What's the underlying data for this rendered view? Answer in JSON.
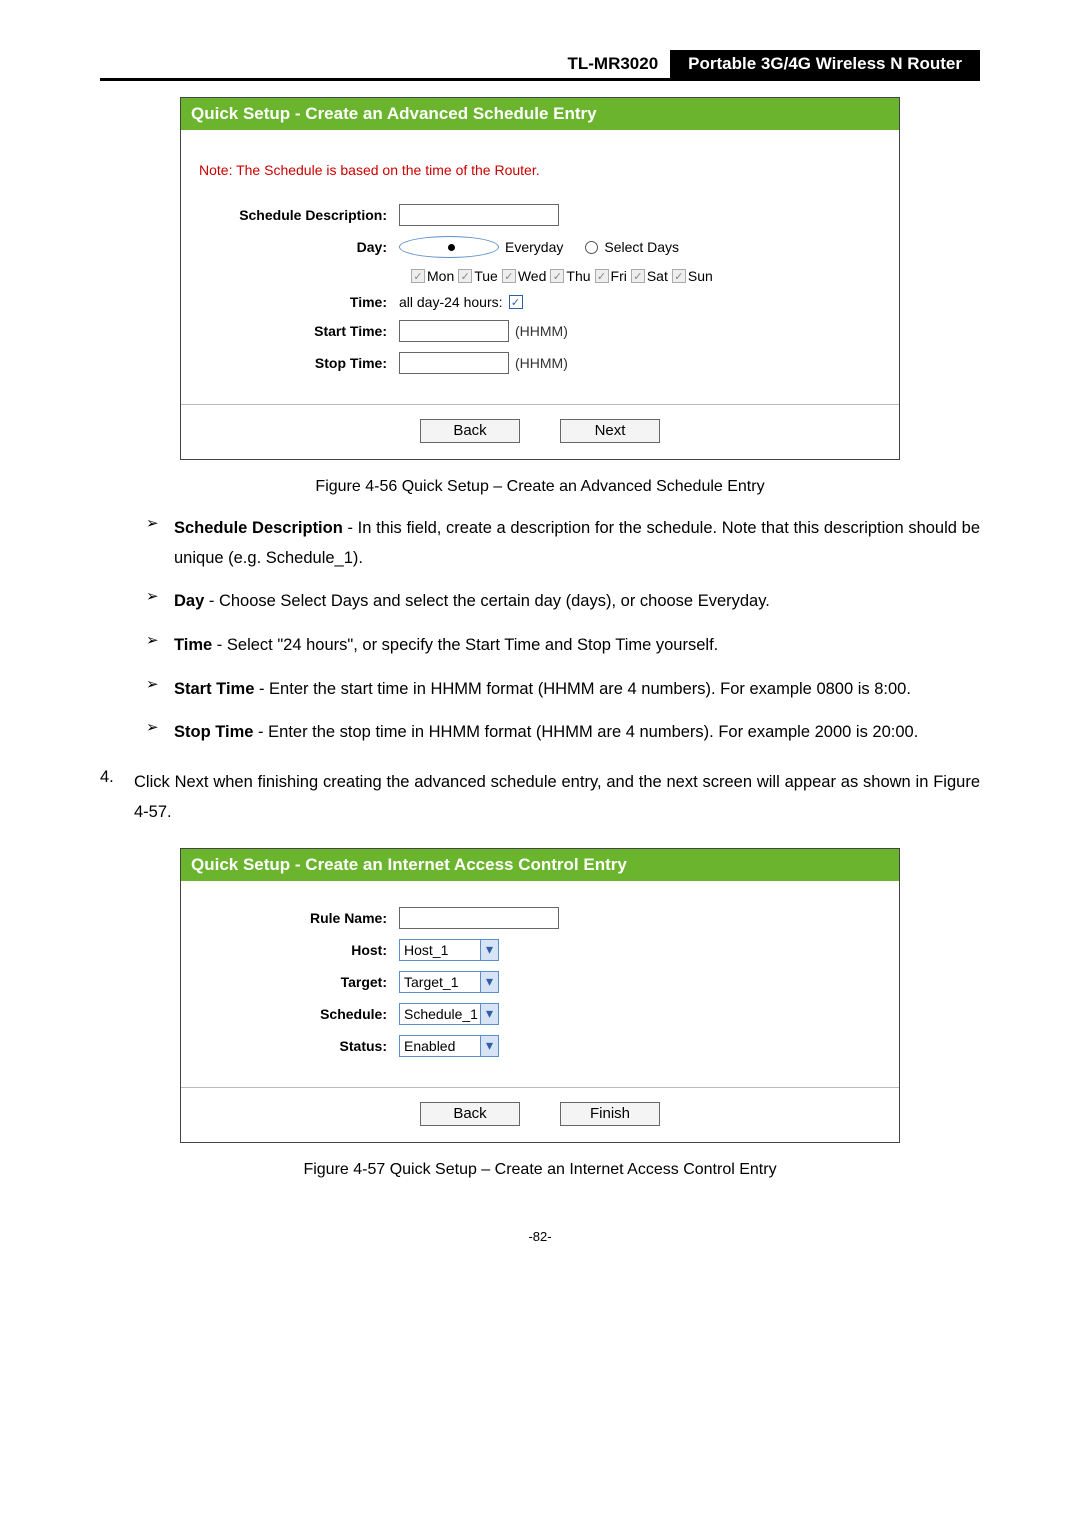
{
  "header": {
    "model": "TL-MR3020",
    "product": "Portable 3G/4G Wireless N Router"
  },
  "fig1": {
    "title": "Quick Setup - Create an Advanced Schedule Entry",
    "note": "Note: The Schedule is based on the time of the Router.",
    "labels": {
      "scheduleDesc": "Schedule Description:",
      "day": "Day:",
      "time": "Time:",
      "startTime": "Start Time:",
      "stopTime": "Stop Time:"
    },
    "dayOpt": {
      "everyday": "Everyday",
      "selectDays": "Select Days"
    },
    "days": [
      "Mon",
      "Tue",
      "Wed",
      "Thu",
      "Fri",
      "Sat",
      "Sun"
    ],
    "timeText": "all day-24 hours:",
    "hhmm": "(HHMM)",
    "buttons": {
      "back": "Back",
      "next": "Next"
    },
    "caption": "Figure 4-56    Quick Setup – Create an Advanced Schedule Entry"
  },
  "bullets": [
    {
      "term": "Schedule Description",
      "text": " - In this field, create a description for the schedule. Note that this description should be unique (e.g. Schedule_1)."
    },
    {
      "term": "Day",
      "text": " - Choose Select Days and select the certain day (days), or choose Everyday."
    },
    {
      "term": "Time",
      "text": " - Select \"24 hours\", or specify the Start Time and Stop Time yourself."
    },
    {
      "term": "Start Time",
      "text": " - Enter the start time in HHMM format (HHMM are 4 numbers). For example 0800 is 8:00."
    },
    {
      "term": "Stop Time",
      "text": " - Enter the stop time in HHMM format (HHMM are 4 numbers). For example 2000 is 20:00."
    }
  ],
  "step4": {
    "num": "4.",
    "pre": "Click ",
    "bold": "Next",
    "post": " when finishing creating the advanced schedule entry, and the next screen will appear as shown in Figure 4-57."
  },
  "fig2": {
    "title": "Quick Setup - Create an Internet Access Control Entry",
    "labels": {
      "ruleName": "Rule Name:",
      "host": "Host:",
      "target": "Target:",
      "schedule": "Schedule:",
      "status": "Status:"
    },
    "values": {
      "host": "Host_1",
      "target": "Target_1",
      "schedule": "Schedule_1",
      "status": "Enabled"
    },
    "buttons": {
      "back": "Back",
      "finish": "Finish"
    },
    "caption": "Figure 4-57    Quick Setup – Create an Internet Access Control Entry"
  },
  "page": "-82-"
}
